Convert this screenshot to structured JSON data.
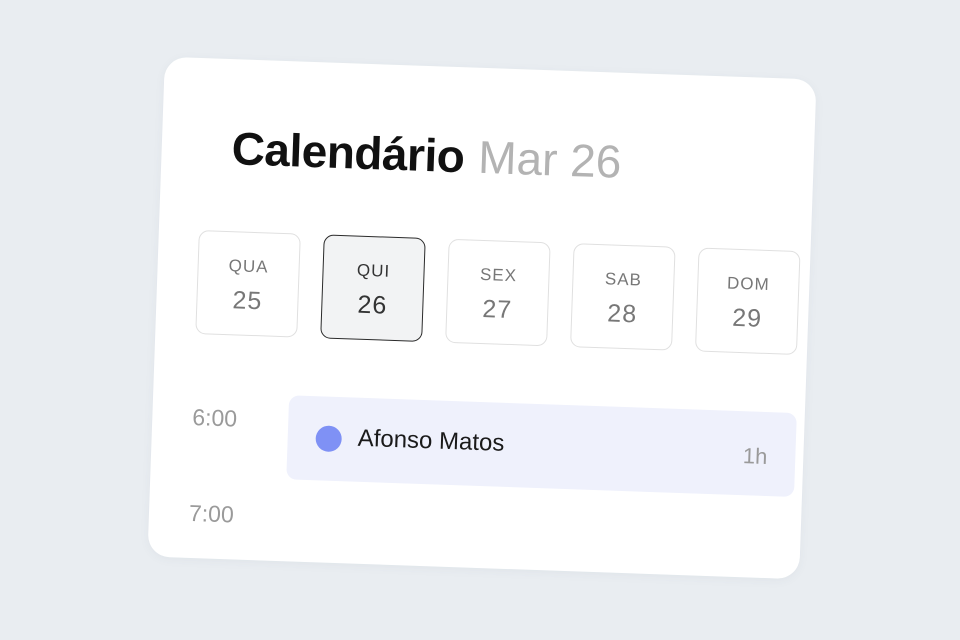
{
  "header": {
    "title": "Calendário",
    "subtitle": "Mar 26"
  },
  "days": [
    {
      "name": "QUA",
      "number": "25",
      "selected": false
    },
    {
      "name": "QUI",
      "number": "26",
      "selected": true
    },
    {
      "name": "SEX",
      "number": "27",
      "selected": false
    },
    {
      "name": "SAB",
      "number": "28",
      "selected": false
    },
    {
      "name": "DOM",
      "number": "29",
      "selected": false
    }
  ],
  "timeline": {
    "times": [
      "6:00",
      "7:00"
    ]
  },
  "event": {
    "name": "Afonso Matos",
    "duration": "1h",
    "color": "#7f91f5"
  },
  "colors": {
    "background": "#e9edf1",
    "card": "#ffffff",
    "event_background": "#eff1fc",
    "selected_border": "#2b2b2b"
  }
}
